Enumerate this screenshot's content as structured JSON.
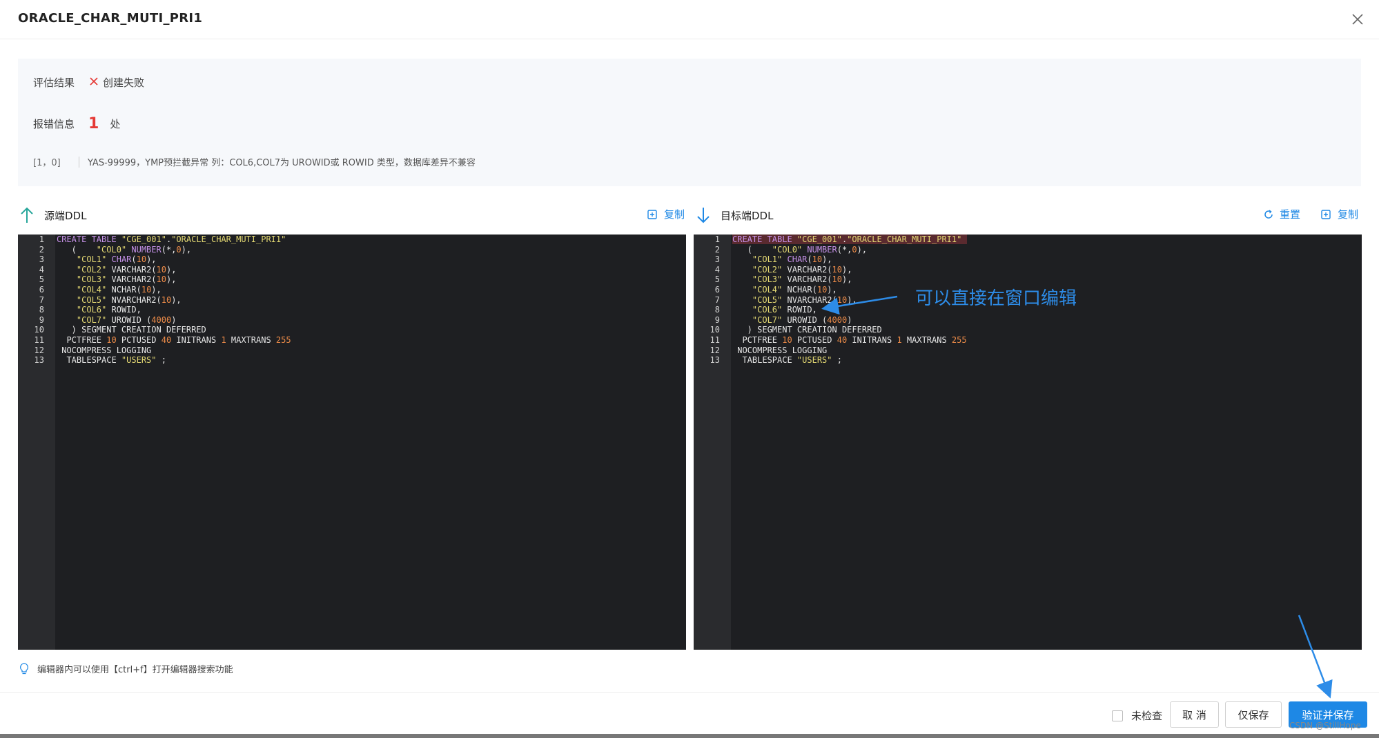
{
  "dialog": {
    "title": "ORACLE_CHAR_MUTI_PRI1"
  },
  "result": {
    "eval_label": "评估结果",
    "eval_status": "创建失败",
    "error_label": "报错信息",
    "error_count": "1",
    "error_unit": "处",
    "errors": [
      {
        "position": "[1，0]",
        "message": "YAS-99999，YMP预拦截异常 列：COL6,COL7为 UROWID或 ROWID 类型，数据库差异不兼容"
      }
    ]
  },
  "source": {
    "title": "源端DDL",
    "copy_label": "复制"
  },
  "target": {
    "title": "目标端DDL",
    "reset_label": "重置",
    "copy_label": "复制"
  },
  "line_numbers": [
    "1",
    "2",
    "3",
    "4",
    "5",
    "6",
    "7",
    "8",
    "9",
    "10",
    "11",
    "12",
    "13"
  ],
  "annotation": {
    "text": "可以直接在窗口编辑",
    "color": "#2d8ce8"
  },
  "tip": {
    "text": "编辑器内可以使用【ctrl+f】打开编辑器搜索功能"
  },
  "footer": {
    "checkbox_label": "未检查",
    "cancel_label": "取 消",
    "save_only_label": "仅保存",
    "verify_save_label": "验证并保存"
  },
  "watermark": "CSDN @StillHope",
  "colors": {
    "primary": "#1e88e5",
    "error": "#e53935",
    "editor_bg": "#1e1f22"
  }
}
